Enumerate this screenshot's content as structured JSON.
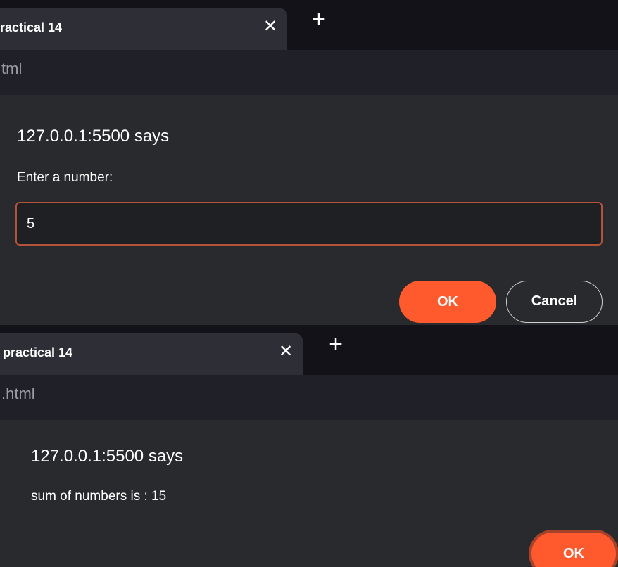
{
  "screens": [
    {
      "tab": {
        "title": "ractical 14",
        "close": "✕",
        "new_tab": "+"
      },
      "url_fragment": "tml",
      "dialog": {
        "title": "127.0.0.1:5500 says",
        "message": "Enter a number:",
        "input_value": "5",
        "ok_label": "OK",
        "cancel_label": "Cancel"
      }
    },
    {
      "tab": {
        "title": "practical 14",
        "close": "✕",
        "new_tab": "+"
      },
      "url_fragment": ".html",
      "dialog": {
        "title": "127.0.0.1:5500 says",
        "message": "sum of numbers is : 15",
        "ok_label": "OK"
      }
    }
  ],
  "colors": {
    "tabstrip_bg": "#121218",
    "active_tab_bg": "#2d2e36",
    "url_bar_bg": "#1f2028",
    "dialog_bg": "#292a2d",
    "accent": "#ff5a2e",
    "input_border": "#b4533a"
  }
}
